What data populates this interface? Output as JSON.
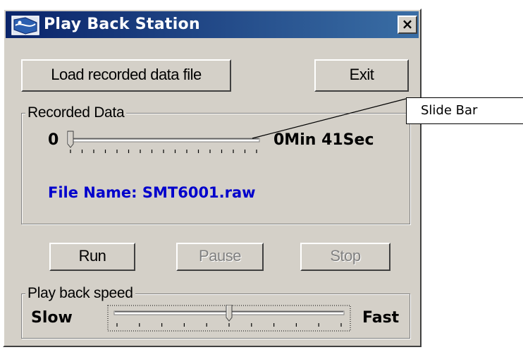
{
  "window": {
    "title": "Play Back Station",
    "close_label": "×",
    "title_gradient": [
      "#0a246a",
      "#3a6ea5"
    ],
    "face_color": "#d4d0c8"
  },
  "top_buttons": {
    "load_label": "Load recorded data file",
    "exit_label": "Exit"
  },
  "recorded_data": {
    "legend": "Recorded Data",
    "start_label": "0",
    "position_fraction": 0.0,
    "duration_label": "0Min 41Sec",
    "file_name": "File Name: SMT6001.raw",
    "file_name_color": "#0000cc"
  },
  "controls": {
    "run_label": "Run",
    "pause_label": "Pause",
    "stop_label": "Stop",
    "pause_enabled": false,
    "stop_enabled": false
  },
  "playback_speed": {
    "legend": "Play back speed",
    "slow_label": "Slow",
    "fast_label": "Fast",
    "level_fraction": 0.5
  },
  "callout": {
    "label": "Slide Bar"
  }
}
